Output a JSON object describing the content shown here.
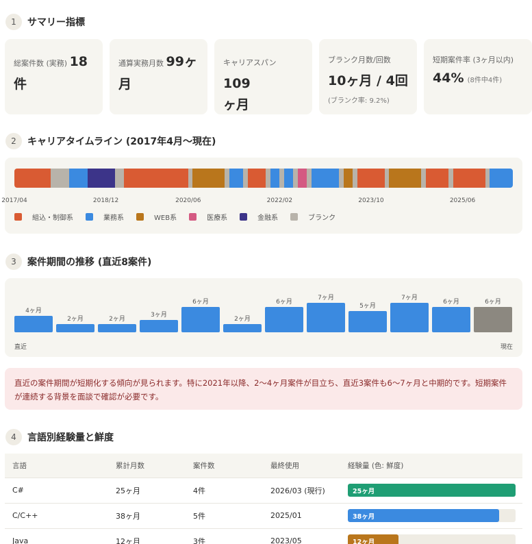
{
  "sections": {
    "s1": {
      "num": "1",
      "title": "サマリー指標"
    },
    "s2": {
      "num": "2",
      "title": "キャリアタイムライン (2017年4月〜現在)"
    },
    "s3": {
      "num": "3",
      "title": "案件期間の推移 (直近8案件)"
    },
    "s4": {
      "num": "4",
      "title": "言語別経験量と鮮度"
    }
  },
  "metrics": {
    "total": {
      "label": "総案件数 (実務) ",
      "value": "18",
      "unit": "件"
    },
    "months": {
      "label": "通算実務月数 ",
      "value": "99ヶ",
      "unit": "月"
    },
    "span": {
      "label": "キャリアスパン ",
      "value": "109",
      "unit": "ヶ月"
    },
    "blank": {
      "label": "ブランク月数/回数",
      "value": "10ヶ月 / 4回",
      "sub": "(ブランク率: 9.2%)"
    },
    "short": {
      "label": "短期案件率 (3ヶ月以内)",
      "value": "44%",
      "sub": " (8件中4件)"
    }
  },
  "timeline": {
    "colors": {
      "embedded": "#d95b33",
      "business": "#3b8ae0",
      "web": "#b9761c",
      "medical": "#d45a82",
      "finance": "#3c3489",
      "blank": "#b8b3aa"
    },
    "segments": [
      {
        "type": "embedded",
        "months": 6
      },
      {
        "type": "blank",
        "months": 3
      },
      {
        "type": "business",
        "months": 3
      },
      {
        "type": "finance",
        "months": 4.5
      },
      {
        "type": "blank",
        "months": 1.5
      },
      {
        "type": "embedded",
        "months": 10.5
      },
      {
        "type": "blank",
        "months": 0.75
      },
      {
        "type": "web",
        "months": 5.25
      },
      {
        "type": "blank",
        "months": 0.75
      },
      {
        "type": "business",
        "months": 2.25
      },
      {
        "type": "blank",
        "months": 0.75
      },
      {
        "type": "embedded",
        "months": 3
      },
      {
        "type": "blank",
        "months": 0.75
      },
      {
        "type": "business",
        "months": 1.5
      },
      {
        "type": "blank",
        "months": 0.75
      },
      {
        "type": "business",
        "months": 1.5
      },
      {
        "type": "blank",
        "months": 0.75
      },
      {
        "type": "medical",
        "months": 1.5
      },
      {
        "type": "blank",
        "months": 0.75
      },
      {
        "type": "business",
        "months": 4.5
      },
      {
        "type": "blank",
        "months": 0.75
      },
      {
        "type": "web",
        "months": 1.5
      },
      {
        "type": "blank",
        "months": 0.75
      },
      {
        "type": "embedded",
        "months": 4.5
      },
      {
        "type": "blank",
        "months": 0.75
      },
      {
        "type": "web",
        "months": 5.25
      },
      {
        "type": "blank",
        "months": 0.75
      },
      {
        "type": "embedded",
        "months": 3.75
      },
      {
        "type": "blank",
        "months": 0.75
      },
      {
        "type": "embedded",
        "months": 5.25
      },
      {
        "type": "blank",
        "months": 0.75
      },
      {
        "type": "business",
        "months": 3.75
      }
    ],
    "ticks": [
      {
        "label": "2017/04",
        "month": 0
      },
      {
        "label": "2018/12",
        "month": 20
      },
      {
        "label": "2020/06",
        "month": 38
      },
      {
        "label": "2022/02",
        "month": 58
      },
      {
        "label": "2023/10",
        "month": 78
      },
      {
        "label": "2025/06",
        "month": 98
      }
    ],
    "legend": [
      {
        "type": "embedded",
        "label": "組込・制御系"
      },
      {
        "type": "business",
        "label": "業務系"
      },
      {
        "type": "web",
        "label": "WEB系"
      },
      {
        "type": "medical",
        "label": "医療系"
      },
      {
        "type": "finance",
        "label": "金融系"
      },
      {
        "type": "blank",
        "label": "ブランク"
      }
    ]
  },
  "chart_data": {
    "type": "bar",
    "categories": [
      "",
      "",
      "",
      "",
      "",
      "",
      "",
      "",
      "",
      "",
      "",
      ""
    ],
    "values": [
      4,
      2,
      2,
      3,
      6,
      2,
      6,
      7,
      5,
      7,
      6,
      6
    ],
    "labels": [
      "4ヶ月",
      "2ヶ月",
      "2ヶ月",
      "3ヶ月",
      "6ヶ月",
      "2ヶ月",
      "6ヶ月",
      "7ヶ月",
      "5ヶ月",
      "7ヶ月",
      "6ヶ月",
      "6ヶ月"
    ],
    "highlight_last": true,
    "colors": {
      "bar": "#3b8ae0",
      "current": "#8c8880"
    },
    "ylim": [
      0,
      7
    ],
    "axis_left": "直近",
    "axis_right": "現在"
  },
  "alert": {
    "text": "直近の案件期間が短期化する傾向が見られます。特に2021年以降、2〜4ヶ月案件が目立ち、直近3案件も6〜7ヶ月と中期的です。短期案件が連続する背景を面談で確認が必要です。"
  },
  "lang_table": {
    "headers": [
      "言語",
      "累計月数",
      "案件数",
      "最終使用",
      "経験量 (色: 鮮度)"
    ],
    "max_months": 38,
    "rows": [
      {
        "lang": "C#",
        "months": "25ヶ月",
        "cases": "4件",
        "last": "2026/03 (現行)",
        "bar_label": "25ヶ月",
        "fill": 1.0,
        "color": "#1f9e74"
      },
      {
        "lang": "C/C++",
        "months": "38ヶ月",
        "cases": "5件",
        "last": "2025/01",
        "bar_label": "38ヶ月",
        "fill": 0.9,
        "color": "#3b8ae0"
      },
      {
        "lang": "Java",
        "months": "12ヶ月",
        "cases": "3件",
        "last": "2023/05",
        "bar_label": "12ヶ月",
        "fill": 0.3,
        "color": "#b9761c"
      }
    ]
  }
}
